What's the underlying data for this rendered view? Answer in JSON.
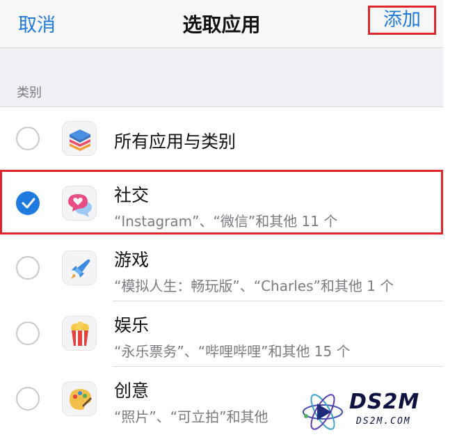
{
  "nav": {
    "cancel_label": "取消",
    "title": "选取应用",
    "add_label": "添加"
  },
  "section": {
    "label": "类别"
  },
  "rows": [
    {
      "title": "所有应用与类别",
      "subtitle": "",
      "checked": false,
      "icon": "stack-icon"
    },
    {
      "title": "社交",
      "subtitle": "“Instagram”、“微信”和其他 11 个",
      "checked": true,
      "icon": "chat-heart-icon"
    },
    {
      "title": "游戏",
      "subtitle": "“模拟人生：畅玩版”、“Charles”和其他 1 个",
      "checked": false,
      "icon": "rocket-icon"
    },
    {
      "title": "娱乐",
      "subtitle": "“永乐票务”、“哔哩哔哩”和其他 15 个",
      "checked": false,
      "icon": "popcorn-icon"
    },
    {
      "title": "创意",
      "subtitle": "“照片”、“可立拍”和其他",
      "checked": false,
      "icon": "palette-icon"
    }
  ],
  "watermark": {
    "text": "DS2M",
    "sub": "DS2M.COM"
  },
  "colors": {
    "accent": "#1f7ae0",
    "highlight": "#e0262b"
  }
}
